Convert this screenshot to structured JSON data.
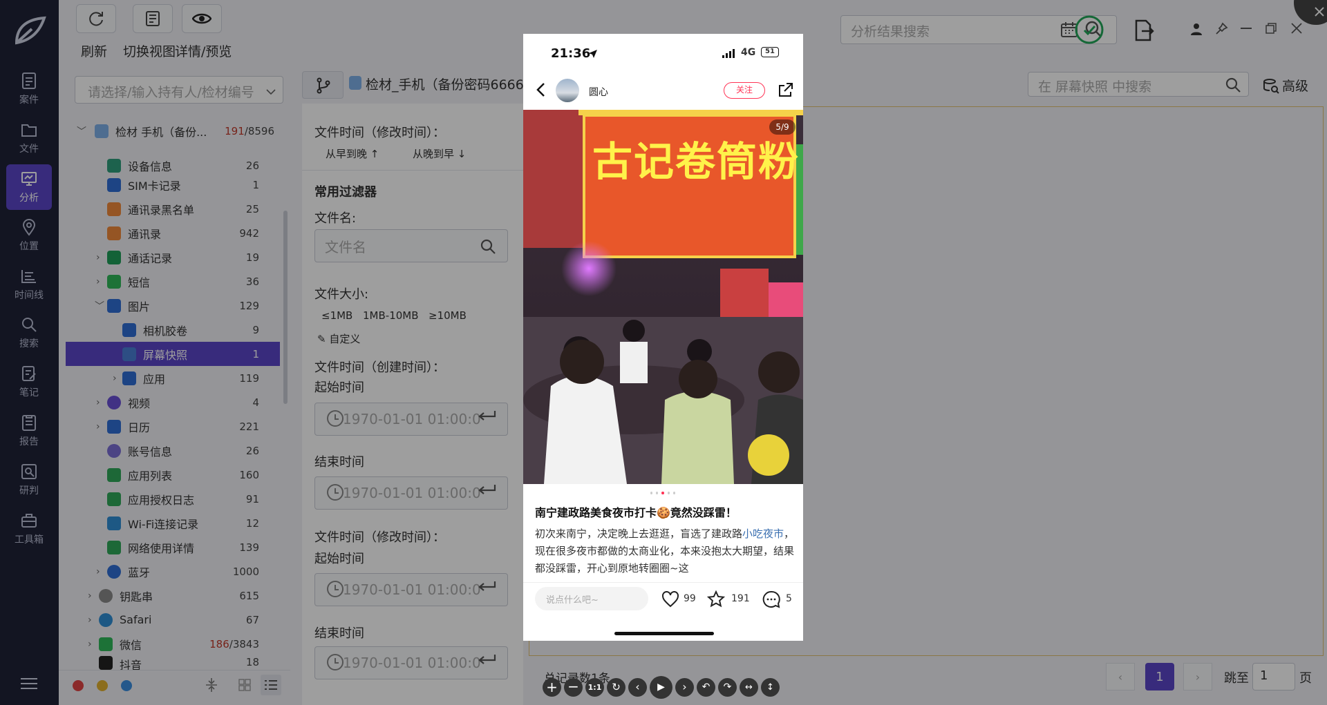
{
  "nav": {
    "items": [
      {
        "label": "案件"
      },
      {
        "label": "文件"
      },
      {
        "label": "分析"
      },
      {
        "label": "位置"
      },
      {
        "label": "时间线"
      },
      {
        "label": "搜索"
      },
      {
        "label": "笔记"
      },
      {
        "label": "报告"
      },
      {
        "label": "研判"
      },
      {
        "label": "工具箱"
      }
    ]
  },
  "toolbar": {
    "refresh_label": "刷新",
    "switch_view_label": "切换视图",
    "detail_preview_label": "详情/预览",
    "search_placeholder": "分析结果搜索"
  },
  "tree": {
    "select_placeholder": "请选择/输入持有人/检材编号",
    "root": {
      "label": "检材 手机（备份...",
      "count_hit": "191",
      "count_total": "/8596"
    },
    "items": [
      {
        "label": "设备信息",
        "count": "26"
      },
      {
        "label": "SIM卡记录",
        "count": "1"
      },
      {
        "label": "通讯录黑名单",
        "count": "25"
      },
      {
        "label": "通讯录",
        "count": "942"
      },
      {
        "label": "通话记录",
        "count": "19"
      },
      {
        "label": "短信",
        "count": "36"
      },
      {
        "label": "图片",
        "count": "129"
      },
      {
        "label": "相机胶卷",
        "count": "9"
      },
      {
        "label": "屏幕快照",
        "count": "1"
      },
      {
        "label": "应用",
        "count": "119"
      },
      {
        "label": "视频",
        "count": "4"
      },
      {
        "label": "日历",
        "count": "221"
      },
      {
        "label": "账号信息",
        "count": "26"
      },
      {
        "label": "应用列表",
        "count": "160"
      },
      {
        "label": "应用授权日志",
        "count": "91"
      },
      {
        "label": "Wi-Fi连接记录",
        "count": "12"
      },
      {
        "label": "网络使用详情",
        "count": "139"
      },
      {
        "label": "蓝牙",
        "count": "1000"
      },
      {
        "label": "钥匙串",
        "count": "615"
      },
      {
        "label": "Safari",
        "count": "67"
      },
      {
        "label": "微信",
        "count_hit": "186",
        "count_total": "/3843"
      },
      {
        "label": "抖音",
        "count": "18"
      }
    ]
  },
  "breadcrumb": {
    "label": "检材_手机（备份密码6666）"
  },
  "screenshot_search": {
    "placeholder": "在 屏幕快照 中搜索",
    "advanced_label": "高级"
  },
  "filter": {
    "mtime_label": "文件时间（修改时间）：",
    "sort_asc": "从早到晚",
    "sort_desc": "从晚到早",
    "common_title": "常用过滤器",
    "filename_label": "文件名:",
    "filename_placeholder": "文件名",
    "size_label": "文件大小:",
    "size_options": [
      "≤1MB",
      "1MB-10MB",
      "≥10MB"
    ],
    "custom_label": "自定义",
    "ctime_label": "文件时间（创建时间）：",
    "start_label": "起始时间",
    "end_label": "结束时间",
    "mtime2_label": "文件时间（修改时间）：",
    "time_value": "1970-01-01 01:00:0"
  },
  "phone": {
    "time": "21:36",
    "network": "4G",
    "battery": "51",
    "username": "圆心",
    "follow_label": "关注",
    "page_indicator": "5/9",
    "sign_text": "古记卷筒粉",
    "post_title": "南宁建政路美食夜市打卡🍪竟然没踩雷！",
    "post_body_1": "初次来南宁，决定晚上去逛逛，盲选了建政路",
    "post_body_link": "小吃夜市",
    "post_body_2": "，现在很多夜市都做的太商业化，本来没抱太大期望，结果都没踩雷，开心到原地转圈圈~这",
    "comment_placeholder": "说点什么吧~",
    "likes": "99",
    "stars": "191",
    "comments": "5"
  },
  "footer": {
    "total_label": "总记录数1条",
    "current_page": "1",
    "jump_label": "跳至",
    "jump_value": "1",
    "page_unit": "页"
  }
}
